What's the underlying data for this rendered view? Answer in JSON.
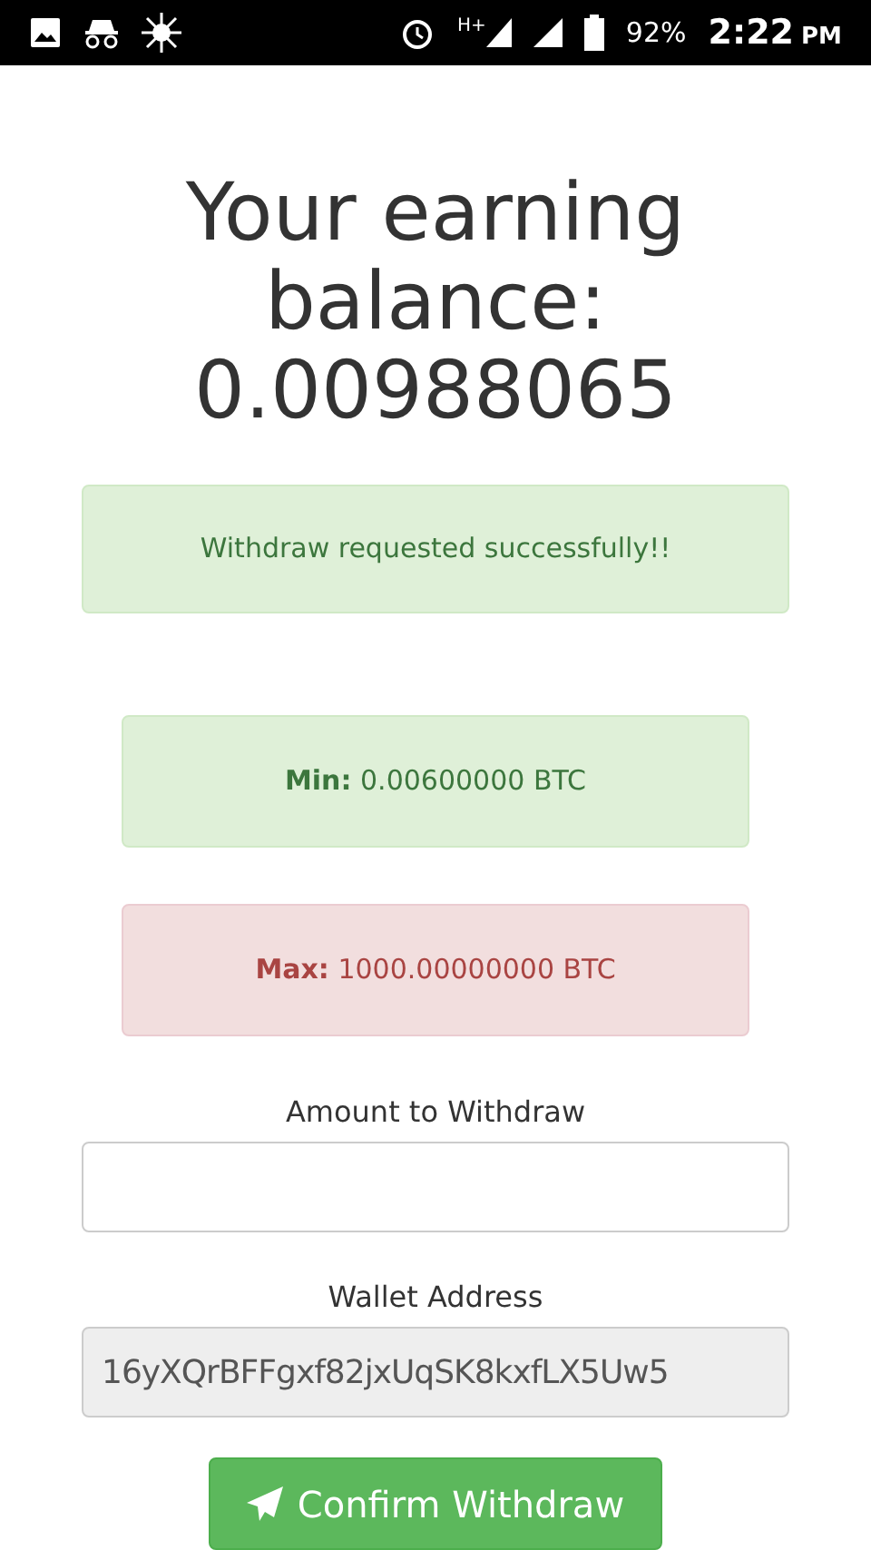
{
  "status_bar": {
    "network": "H+",
    "battery": "92%",
    "time": "2:22",
    "ampm": "PM"
  },
  "title": "Your earning balance: 0.00988065",
  "alerts": [
    {
      "kind": "success",
      "text": "Withdraw requested successfully!!"
    }
  ],
  "limits": [
    {
      "kind": "success",
      "label": "Min:",
      "value": "0.00600000 BTC"
    },
    {
      "kind": "danger",
      "label": "Max:",
      "value": "1000.00000000 BTC"
    }
  ],
  "fields": [
    {
      "label": "Amount to Withdraw",
      "disabled": false
    },
    {
      "label": "Wallet Address",
      "value": "16yXQrBFFgxf82jxUqSK8kxfLX5Uw5",
      "disabled": true
    }
  ],
  "button": {
    "label": "Confirm Withdraw"
  }
}
